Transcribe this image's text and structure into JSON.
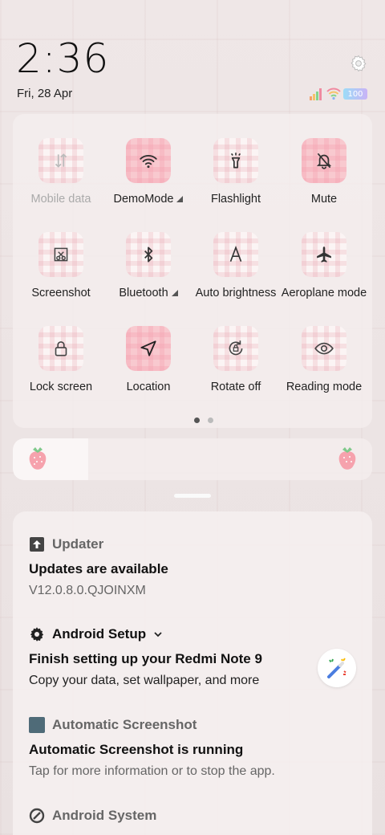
{
  "status": {
    "time": "2:36",
    "date": "Fri, 28 Apr",
    "battery": "100"
  },
  "quick_settings": {
    "tiles": [
      {
        "label": "Mobile data",
        "icon": "mobile-data-icon",
        "active": false,
        "disabled": true,
        "has_arrow": false
      },
      {
        "label": "DemoMode",
        "icon": "wifi-icon",
        "active": true,
        "disabled": false,
        "has_arrow": true
      },
      {
        "label": "Flashlight",
        "icon": "flashlight-icon",
        "active": false,
        "disabled": false,
        "has_arrow": false
      },
      {
        "label": "Mute",
        "icon": "mute-bell-icon",
        "active": true,
        "disabled": false,
        "has_arrow": false
      },
      {
        "label": "Screenshot",
        "icon": "screenshot-icon",
        "active": false,
        "disabled": false,
        "has_arrow": false
      },
      {
        "label": "Bluetooth",
        "icon": "bluetooth-icon",
        "active": false,
        "disabled": false,
        "has_arrow": true
      },
      {
        "label": "Auto brightness",
        "icon": "auto-brightness-icon",
        "active": false,
        "disabled": false,
        "has_arrow": false
      },
      {
        "label": "Aeroplane mode",
        "icon": "airplane-icon",
        "active": false,
        "disabled": false,
        "has_arrow": false
      },
      {
        "label": "Lock screen",
        "icon": "lock-icon",
        "active": false,
        "disabled": false,
        "has_arrow": false
      },
      {
        "label": "Location",
        "icon": "location-icon",
        "active": true,
        "disabled": false,
        "has_arrow": false
      },
      {
        "label": "Rotate off",
        "icon": "rotate-lock-icon",
        "active": false,
        "disabled": false,
        "has_arrow": false
      },
      {
        "label": "Reading mode",
        "icon": "eye-icon",
        "active": false,
        "disabled": false,
        "has_arrow": false
      }
    ],
    "page_count": 2,
    "current_page": 1
  },
  "brightness": {
    "level": 0.21
  },
  "notifications": [
    {
      "app": "Updater",
      "icon": "upload-arrow-icon",
      "title": "Updates are available",
      "body": "V12.0.8.0.QJOINXM"
    },
    {
      "app": "Android Setup",
      "icon": "gear-icon",
      "title": "Finish setting up your Redmi Note 9",
      "body": "Copy your data, set wallpaper, and more"
    },
    {
      "app": "Automatic Screenshot",
      "icon": "app-square-icon",
      "title": "Automatic Screenshot is running",
      "body": "Tap for more information or to stop the app."
    },
    {
      "app": "Android System",
      "icon": "android-system-icon",
      "title": "",
      "body": ""
    }
  ],
  "colors": {
    "active_tile": "#f8c9cf",
    "accent_pink": "#f5a0af"
  }
}
